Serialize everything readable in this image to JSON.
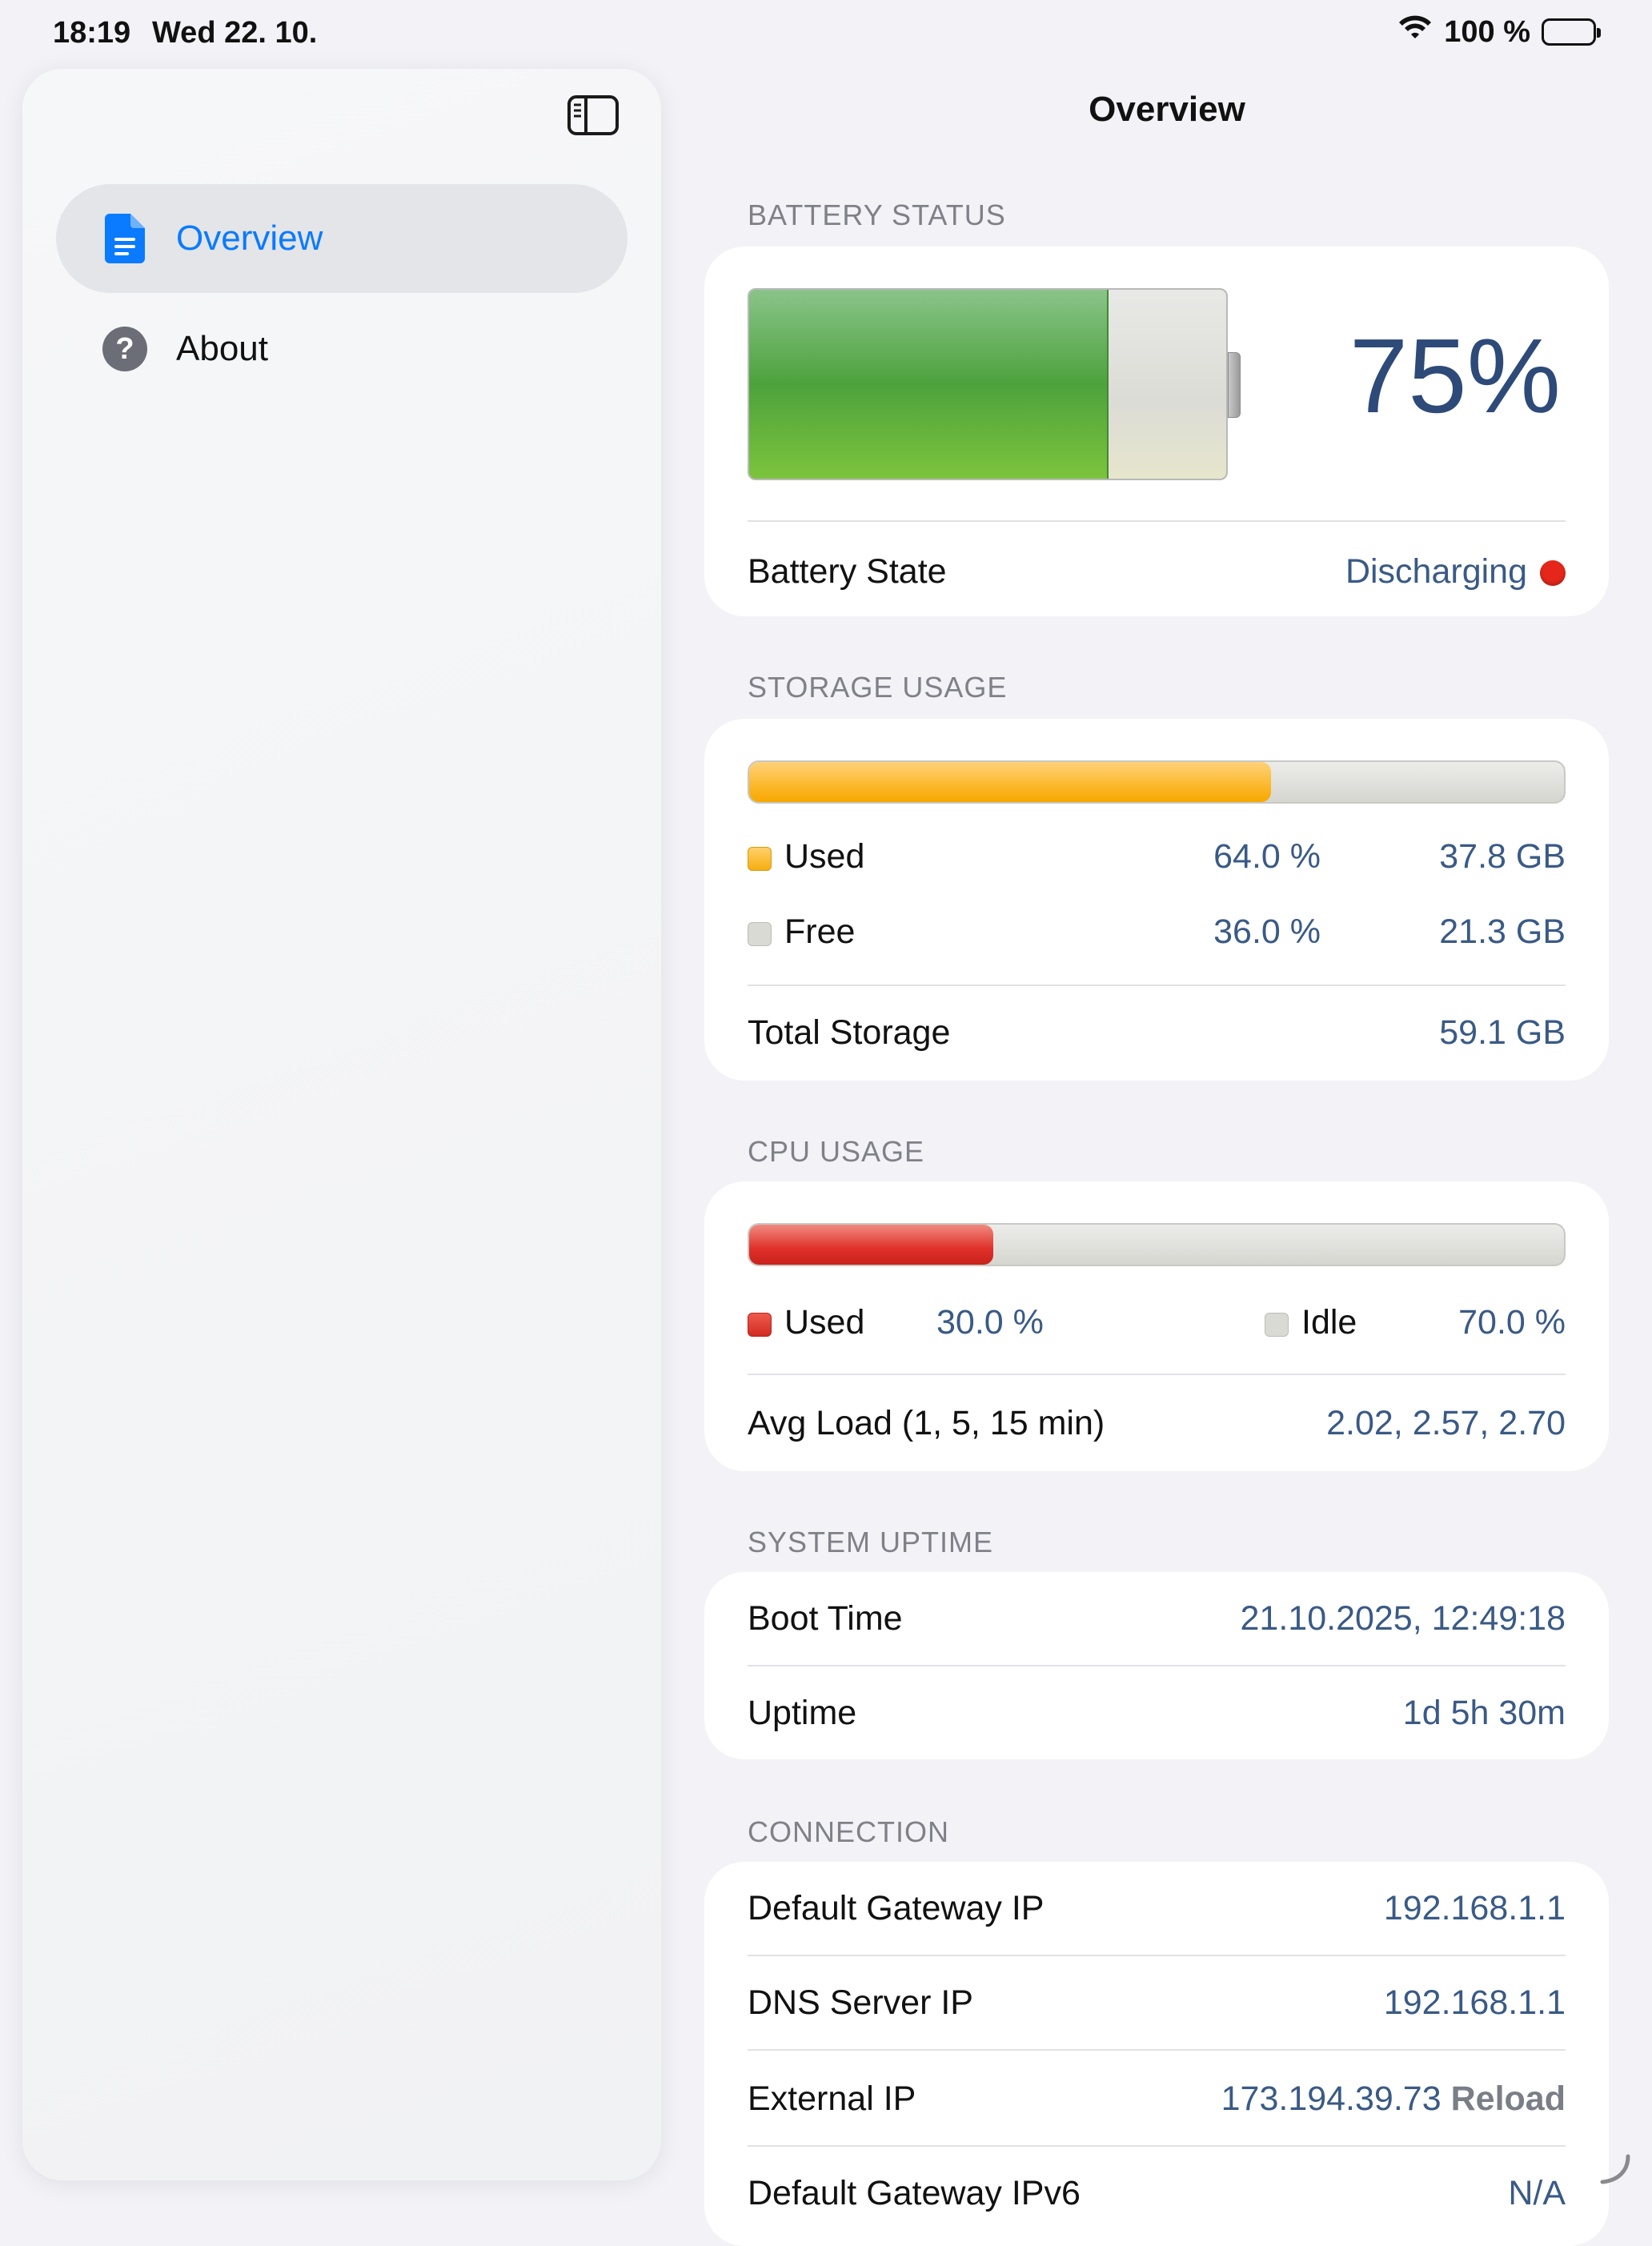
{
  "status_bar": {
    "time": "18:19",
    "date": "Wed 22. 10.",
    "battery": "100 %"
  },
  "sidebar": {
    "items": [
      {
        "label": "Overview",
        "selected": true
      },
      {
        "label": "About",
        "selected": false
      }
    ]
  },
  "main": {
    "title": "Overview",
    "battery": {
      "header": "BATTERY STATUS",
      "percent_text": "75%",
      "level": 0.75,
      "state_label": "Battery State",
      "state_value": "Discharging",
      "state_color": "#e5271b"
    },
    "storage": {
      "header": "STORAGE USAGE",
      "used_fraction": 0.64,
      "used_label": "Used",
      "used_percent": "64.0 %",
      "used_size": "37.8 GB",
      "free_label": "Free",
      "free_percent": "36.0 %",
      "free_size": "21.3 GB",
      "total_label": "Total Storage",
      "total_value": "59.1 GB"
    },
    "cpu": {
      "header": "CPU USAGE",
      "used_fraction": 0.3,
      "used_label": "Used",
      "used_percent": "30.0 %",
      "idle_label": "Idle",
      "idle_percent": "70.0 %",
      "load_label": "Avg Load (1, 5, 15 min)",
      "load_value": "2.02, 2.57, 2.70"
    },
    "uptime": {
      "header": "SYSTEM UPTIME",
      "boot_label": "Boot Time",
      "boot_value": "21.10.2025, 12:49:18",
      "uptime_label": "Uptime",
      "uptime_value": "1d 5h 30m"
    },
    "connection": {
      "header": "CONNECTION",
      "gateway_label": "Default Gateway IP",
      "gateway_value": "192.168.1.1",
      "dns_label": "DNS Server IP",
      "dns_value": "192.168.1.1",
      "external_label": "External IP",
      "external_value": "173.194.39.73",
      "reload_label": "Reload",
      "gateway6_label": "Default Gateway IPv6",
      "gateway6_value": "N/A"
    }
  },
  "colors": {
    "accent": "#0a7aff",
    "value": "#3a5a86",
    "storage_used": "#fbb82a",
    "cpu_used": "#e0302a",
    "battery_fill": "#4da23d"
  }
}
